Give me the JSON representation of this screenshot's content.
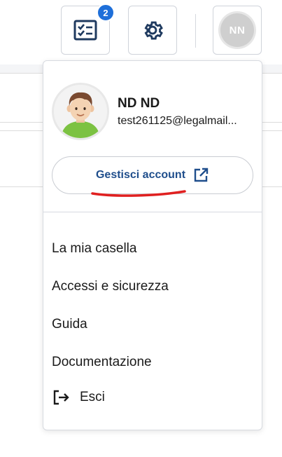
{
  "toolbar": {
    "tasks_badge": "2",
    "tasks_icon": "checklist-icon",
    "settings_icon": "gear-icon",
    "avatar_initials": "NN"
  },
  "account_menu": {
    "user_name": "ND ND",
    "user_email": "test261125@legalmail...",
    "manage_label": "Gestisci account",
    "manage_icon": "external-link-icon",
    "items": [
      {
        "label": "La mia casella"
      },
      {
        "label": "Accessi e sicurezza"
      },
      {
        "label": "Guida"
      },
      {
        "label": "Documentazione"
      }
    ],
    "logout_label": "Esci",
    "logout_icon": "logout-icon"
  },
  "colors": {
    "accent": "#1e6fd9",
    "link_text": "#1f4e8c",
    "icon_navy": "#1f3a5f",
    "annotation_red": "#e02020"
  }
}
